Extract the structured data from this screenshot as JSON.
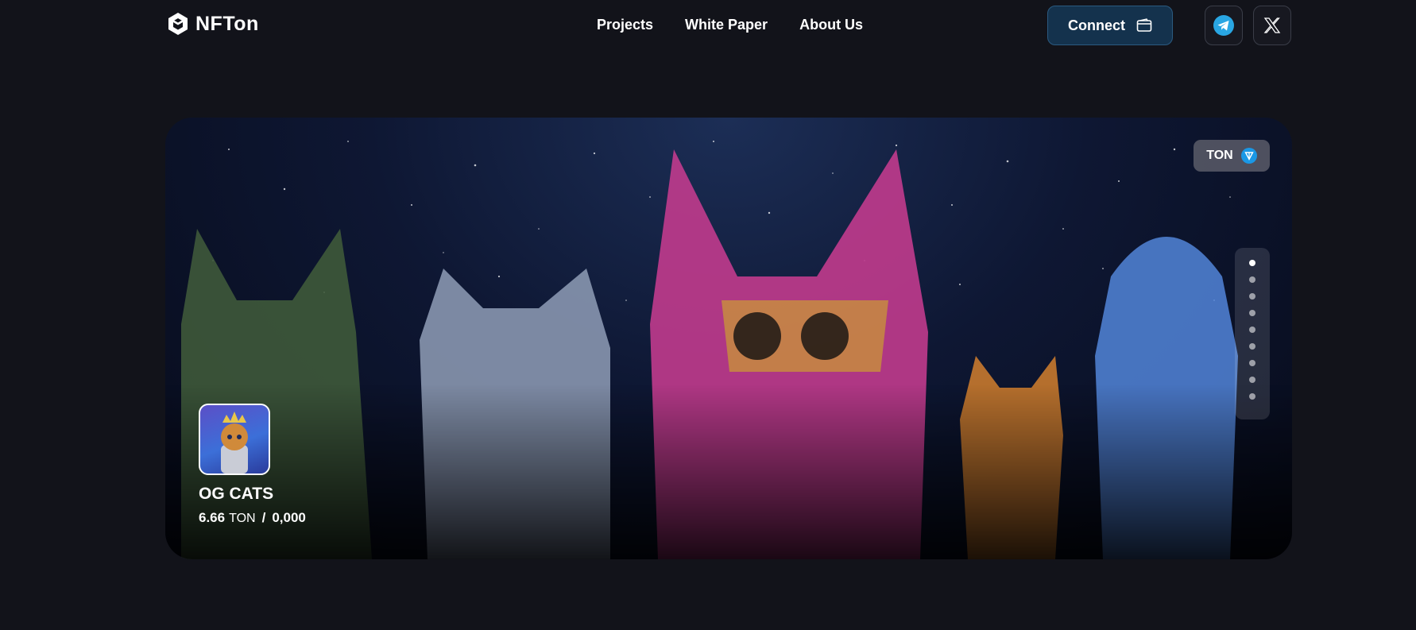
{
  "header": {
    "logo_text": "NFTon",
    "nav": [
      {
        "label": "Projects"
      },
      {
        "label": "White Paper"
      },
      {
        "label": "About Us"
      }
    ],
    "connect_label": "Connect",
    "connect_icon": "wallet-icon",
    "socials": [
      {
        "icon": "telegram-icon"
      },
      {
        "icon": "x-twitter-icon"
      }
    ]
  },
  "hero": {
    "chain_label": "TON",
    "chain_icon": "ton-icon",
    "collection": {
      "name": "OG CATS",
      "price": "6.66",
      "price_unit": "TON",
      "separator": "/",
      "supply": "0,000"
    },
    "pager": {
      "count": 9,
      "active": 0
    }
  },
  "colors": {
    "background": "#12131a",
    "connect_bg": "#14324d",
    "ton_blue": "#1a98e6"
  }
}
